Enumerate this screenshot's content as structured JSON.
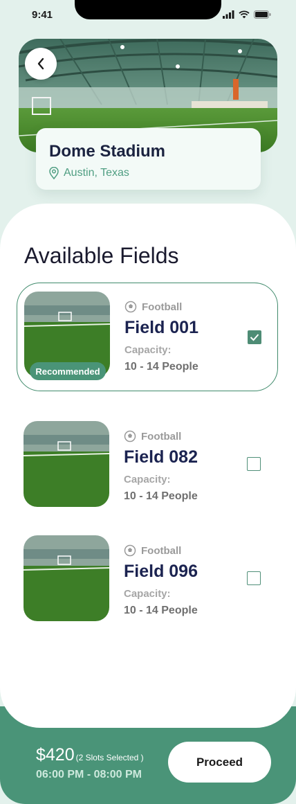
{
  "status_bar": {
    "time": "9:41"
  },
  "venue": {
    "name": "Dome Stadium",
    "location": "Austin, Texas"
  },
  "main": {
    "title": "Available Fields"
  },
  "fields": [
    {
      "sport": "Football",
      "name": "Field 001",
      "capacity_label": "Capacity:",
      "capacity_value": "10 - 14 People",
      "badge": "Recommended",
      "checked": true
    },
    {
      "sport": "Football",
      "name": "Field 082",
      "capacity_label": "Capacity:",
      "capacity_value": "10 - 14 People",
      "checked": false
    },
    {
      "sport": "Football",
      "name": "Field 096",
      "capacity_label": "Capacity:",
      "capacity_value": "10 - 14 People",
      "checked": false
    }
  ],
  "footer": {
    "price": "$420",
    "slots": "(2 Slots Selected )",
    "time_range": "06:00 PM - 08:00 PM",
    "proceed_label": "Proceed"
  },
  "colors": {
    "accent": "#4a9478",
    "background": "#e3f1ec",
    "title": "#1b2350"
  },
  "icons": [
    "back-arrow-icon",
    "location-pin-icon",
    "football-icon",
    "checkmark-icon",
    "signal-icon",
    "wifi-icon",
    "battery-icon"
  ]
}
